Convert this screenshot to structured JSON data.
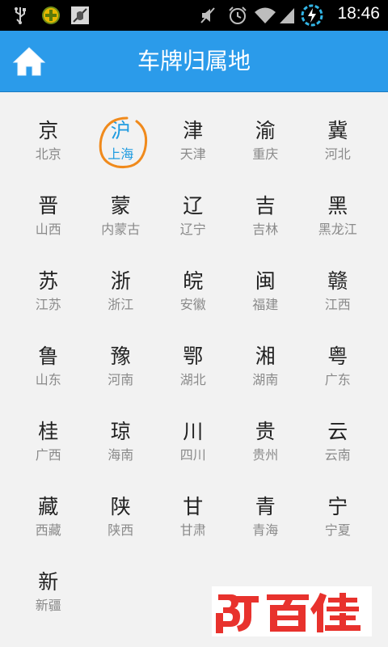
{
  "status_bar": {
    "time": "18:46",
    "icons": [
      "usb-icon",
      "plus-app-icon",
      "debug-icon",
      "mute-icon",
      "alarm-icon",
      "wifi-icon",
      "signal-icon",
      "battery-charging-icon"
    ]
  },
  "header": {
    "title": "车牌归属地",
    "home_icon": "home-icon"
  },
  "provinces": [
    {
      "abbr": "京",
      "name": "北京"
    },
    {
      "abbr": "沪",
      "name": "上海",
      "selected": true
    },
    {
      "abbr": "津",
      "name": "天津"
    },
    {
      "abbr": "渝",
      "name": "重庆"
    },
    {
      "abbr": "冀",
      "name": "河北"
    },
    {
      "abbr": "晋",
      "name": "山西"
    },
    {
      "abbr": "蒙",
      "name": "内蒙古"
    },
    {
      "abbr": "辽",
      "name": "辽宁"
    },
    {
      "abbr": "吉",
      "name": "吉林"
    },
    {
      "abbr": "黑",
      "name": "黑龙江"
    },
    {
      "abbr": "苏",
      "name": "江苏"
    },
    {
      "abbr": "浙",
      "name": "浙江"
    },
    {
      "abbr": "皖",
      "name": "安徽"
    },
    {
      "abbr": "闽",
      "name": "福建"
    },
    {
      "abbr": "赣",
      "name": "江西"
    },
    {
      "abbr": "鲁",
      "name": "山东"
    },
    {
      "abbr": "豫",
      "name": "河南"
    },
    {
      "abbr": "鄂",
      "name": "湖北"
    },
    {
      "abbr": "湘",
      "name": "湖南"
    },
    {
      "abbr": "粤",
      "name": "广东"
    },
    {
      "abbr": "桂",
      "name": "广西"
    },
    {
      "abbr": "琼",
      "name": "海南"
    },
    {
      "abbr": "川",
      "name": "四川"
    },
    {
      "abbr": "贵",
      "name": "贵州"
    },
    {
      "abbr": "云",
      "name": "云南"
    },
    {
      "abbr": "藏",
      "name": "西藏"
    },
    {
      "abbr": "陕",
      "name": "陕西"
    },
    {
      "abbr": "甘",
      "name": "甘肃"
    },
    {
      "abbr": "青",
      "name": "青海"
    },
    {
      "abbr": "宁",
      "name": "宁夏"
    },
    {
      "abbr": "新",
      "name": "新疆"
    }
  ],
  "colors": {
    "header": "#2b9bea",
    "selected": "#1e9be0",
    "highlight_circle": "#f08a1c",
    "watermark_red": "#e8322d"
  },
  "watermark": {
    "text": "百佳"
  }
}
